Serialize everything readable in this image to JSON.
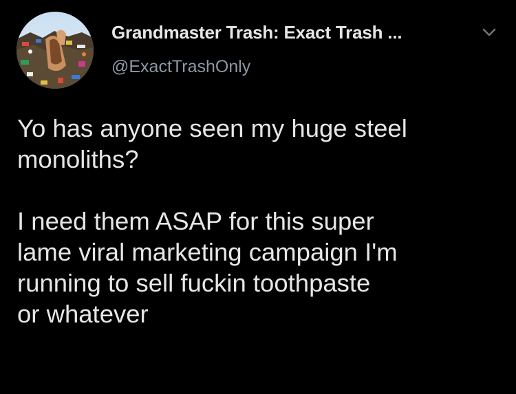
{
  "tweet": {
    "author": {
      "display_name": "Grandmaster Trash: Exact Trash ...",
      "handle": "@ExactTrashOnly",
      "avatar_icon": "avatar-trash-heap-image"
    },
    "menu_icon": "chevron-down-icon",
    "paragraphs": [
      "Yo has anyone seen my huge steel\nmonoliths?",
      "I need them ASAP for this super\nlame viral marketing campaign I'm\nrunning to sell fuckin toothpaste\nor whatever"
    ]
  },
  "colors": {
    "background": "#000000",
    "text": "#e6e6e6",
    "secondary_text": "#8b98a5",
    "chevron": "#6e767d"
  }
}
